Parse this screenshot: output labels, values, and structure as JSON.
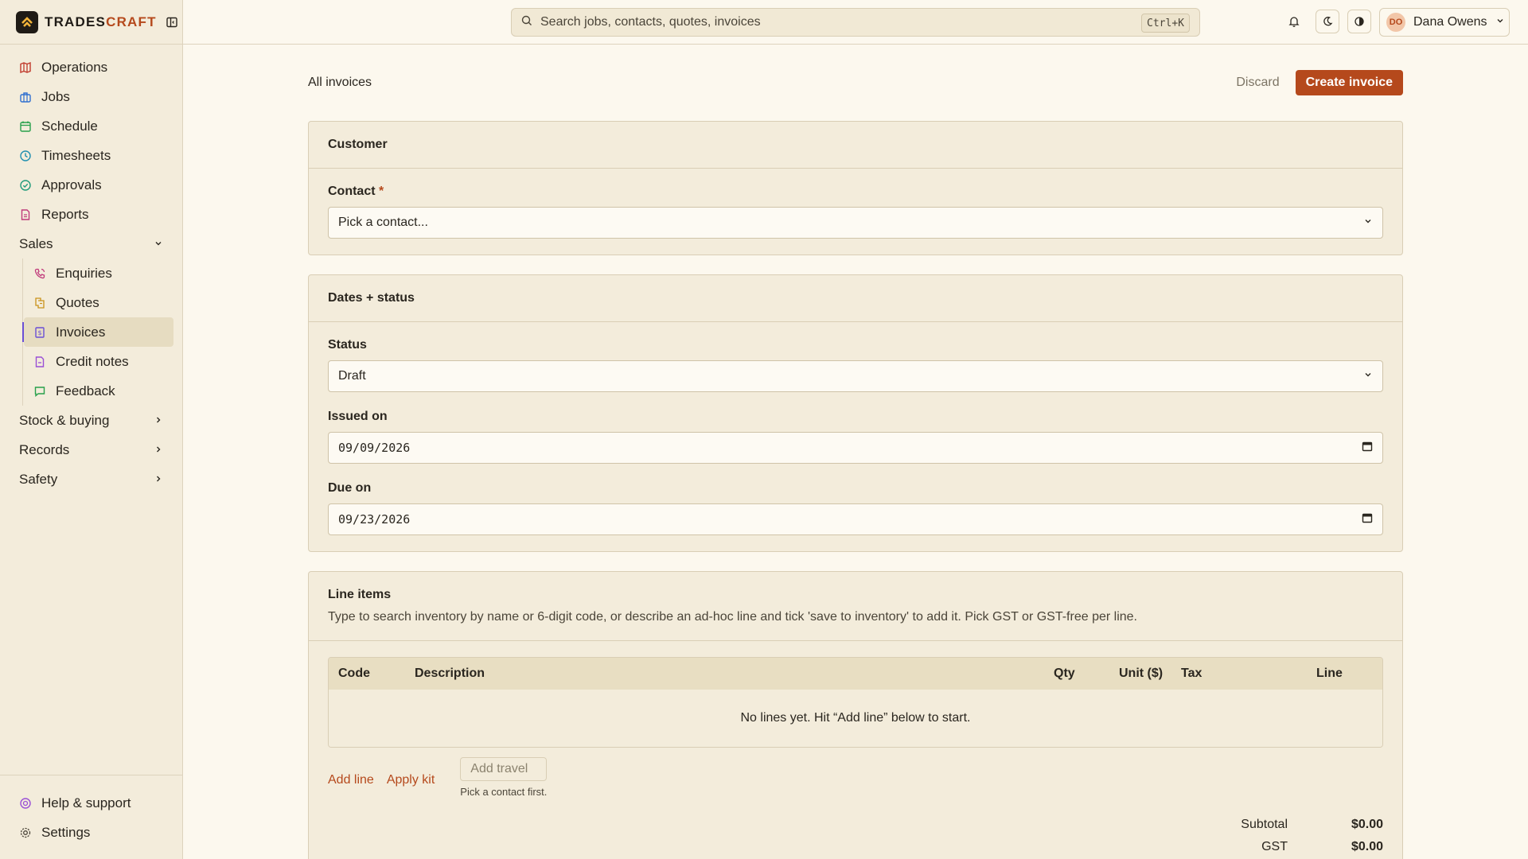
{
  "brand": {
    "name_main": "TRADES",
    "name_accent": "CRAFT"
  },
  "sidebar": {
    "items": [
      {
        "label": "Operations",
        "icon": "map-icon",
        "color": "#c0392b"
      },
      {
        "label": "Jobs",
        "icon": "briefcase-icon",
        "color": "#2f6fd0"
      },
      {
        "label": "Schedule",
        "icon": "calendar-icon",
        "color": "#27a04b"
      },
      {
        "label": "Timesheets",
        "icon": "clock-icon",
        "color": "#1f8fb0"
      },
      {
        "label": "Approvals",
        "icon": "check-circle-icon",
        "color": "#1f9a7a"
      },
      {
        "label": "Reports",
        "icon": "report-icon",
        "color": "#c0397a"
      }
    ],
    "sales": {
      "label": "Sales",
      "items": [
        {
          "label": "Enquiries",
          "icon": "phone-icon"
        },
        {
          "label": "Quotes",
          "icon": "quote-icon"
        },
        {
          "label": "Invoices",
          "icon": "invoice-icon"
        },
        {
          "label": "Credit notes",
          "icon": "credit-note-icon"
        },
        {
          "label": "Feedback",
          "icon": "chat-icon"
        }
      ]
    },
    "groups": [
      "Stock & buying",
      "Records",
      "Safety"
    ],
    "footer": {
      "help": "Help & support",
      "settings": "Settings"
    }
  },
  "topbar": {
    "search_placeholder": "Search jobs, contacts, quotes, invoices",
    "shortcut": "Ctrl+K",
    "user": {
      "initials": "DO",
      "name": "Dana Owens"
    }
  },
  "page": {
    "breadcrumb": "All invoices",
    "discard": "Discard",
    "create": "Create invoice"
  },
  "customer": {
    "title": "Customer",
    "contact_label": "Contact",
    "required_mark": "*",
    "contact_placeholder": "Pick a contact..."
  },
  "dates": {
    "title": "Dates + status",
    "status_label": "Status",
    "status_value": "Draft",
    "issued_label": "Issued on",
    "issued_value": "09/09/2026",
    "due_label": "Due on",
    "due_value": "09/23/2026"
  },
  "lines": {
    "title": "Line items",
    "description": "Type to search inventory by name or 6-digit code, or describe an ad-hoc line and tick 'save to inventory' to add it. Pick GST or GST-free per line.",
    "columns": {
      "code": "Code",
      "description": "Description",
      "qty": "Qty",
      "unit": "Unit ($)",
      "tax": "Tax",
      "line": "Line"
    },
    "empty": "No lines yet. Hit “Add line” below to start.",
    "add_line": "Add line",
    "apply_kit": "Apply kit",
    "add_travel": "Add travel",
    "travel_hint": "Pick a contact first.",
    "subtotal_label": "Subtotal",
    "subtotal_value": "$0.00",
    "gst_label": "GST",
    "gst_value": "$0.00"
  },
  "colors": {
    "accent": "#b5491c",
    "active_indicator": "#6a4fd6"
  }
}
